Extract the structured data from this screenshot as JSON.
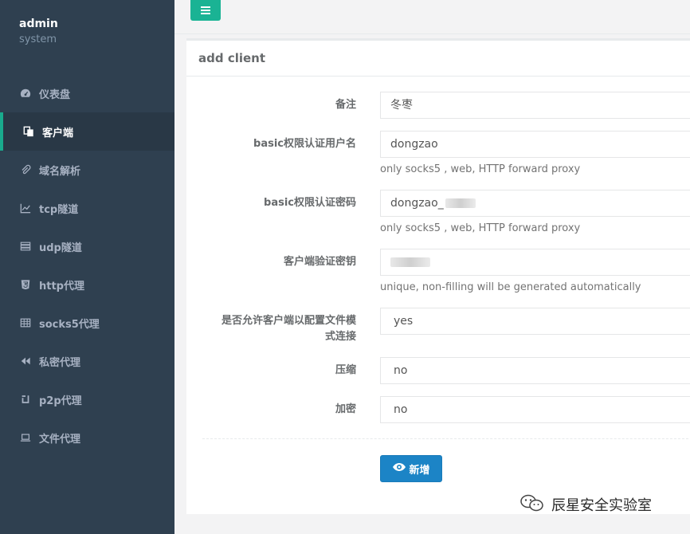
{
  "profile": {
    "name": "admin",
    "role": "system"
  },
  "nav": [
    {
      "label": "仪表盘",
      "icon": "dashboard-icon"
    },
    {
      "label": "客户端",
      "icon": "copy-icon",
      "active": true
    },
    {
      "label": "域名解析",
      "icon": "paperclip-icon"
    },
    {
      "label": "tcp隧道",
      "icon": "line-chart-icon"
    },
    {
      "label": "udp隧道",
      "icon": "server-icon"
    },
    {
      "label": "http代理",
      "icon": "html5-icon"
    },
    {
      "label": "socks5代理",
      "icon": "table-icon"
    },
    {
      "label": "私密代理",
      "icon": "backward-icon"
    },
    {
      "label": "p2p代理",
      "icon": "square-icon"
    },
    {
      "label": "文件代理",
      "icon": "laptop-icon"
    }
  ],
  "toolbar": {
    "menu_toggle_icon": "bars-icon"
  },
  "panel": {
    "title": "add client"
  },
  "form": {
    "remark": {
      "label": "备注",
      "value": "冬枣"
    },
    "basic_user": {
      "label": "basic权限认证用户名",
      "value": "dongzao",
      "help": "only socks5 , web, HTTP forward proxy"
    },
    "basic_pass": {
      "label": "basic权限认证密码",
      "value": "dongzao_",
      "help": "only socks5 , web, HTTP forward proxy"
    },
    "vkey": {
      "label": "客户端验证密钥",
      "value": "",
      "help": "unique, non-filling will be generated automatically"
    },
    "config_conn": {
      "label_line1": "是否允许客户端以配置文件模",
      "label_line2": "式连接",
      "value": "yes"
    },
    "compress": {
      "label": "压缩",
      "value": "no"
    },
    "crypt": {
      "label": "加密",
      "value": "no"
    },
    "submit_label": "新增"
  },
  "watermark": {
    "text": "辰星安全实验室"
  },
  "colors": {
    "sidebar": "#2f4050",
    "accent": "#1ab394",
    "primary": "#1c84c6"
  }
}
